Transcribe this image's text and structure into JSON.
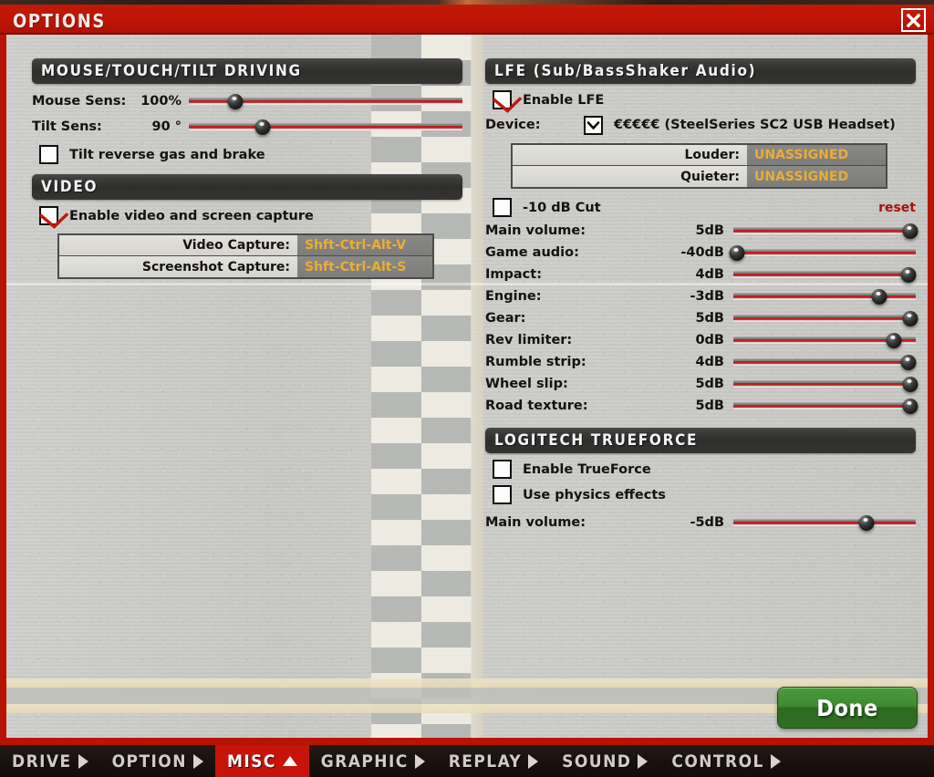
{
  "window": {
    "title": "OPTIONS",
    "close_icon": "close-x-icon"
  },
  "left_column": {
    "driving_section": {
      "header": "MOUSE/TOUCH/TILT DRIVING",
      "rows": [
        {
          "label": "Mouse Sens:",
          "value": "100%",
          "slider_pct": 17
        },
        {
          "label": "Tilt Sens:",
          "value": "90 °",
          "slider_pct": 27
        }
      ],
      "checkbox": {
        "label": "Tilt reverse gas and brake",
        "checked": false
      }
    },
    "video_section": {
      "header": "VIDEO",
      "checkbox": {
        "label": "Enable video and screen capture",
        "checked": true
      },
      "keybinds": [
        {
          "name": "Video Capture:",
          "value": "Shft-Ctrl-Alt-V"
        },
        {
          "name": "Screenshot Capture:",
          "value": "Shft-Ctrl-Alt-S"
        }
      ]
    }
  },
  "right_column": {
    "lfe_section": {
      "header": "LFE (Sub/BassShaker Audio)",
      "enable_checkbox": {
        "label": "Enable LFE",
        "checked": true
      },
      "device_label": "Device:",
      "device_value": "€€€€€ (SteelSeries SC2 USB Headset)",
      "device_icon": "chevron-down-icon",
      "keybinds": [
        {
          "name": "Louder:",
          "value": "UNASSIGNED"
        },
        {
          "name": "Quieter:",
          "value": "UNASSIGNED"
        }
      ],
      "cut_checkbox": {
        "label": "-10 dB Cut",
        "checked": false
      },
      "reset_label": "reset",
      "sliders": [
        {
          "label": "Main volume:",
          "value": "5dB",
          "slider_pct": 97
        },
        {
          "label": "Game audio:",
          "value": "-40dB",
          "slider_pct": 2
        },
        {
          "label": "Impact:",
          "value": "4dB",
          "slider_pct": 96
        },
        {
          "label": "Engine:",
          "value": "-3dB",
          "slider_pct": 80
        },
        {
          "label": "Gear:",
          "value": "5dB",
          "slider_pct": 97
        },
        {
          "label": "Rev limiter:",
          "value": "0dB",
          "slider_pct": 88
        },
        {
          "label": "Rumble strip:",
          "value": "4dB",
          "slider_pct": 96
        },
        {
          "label": "Wheel slip:",
          "value": "5dB",
          "slider_pct": 97
        },
        {
          "label": "Road texture:",
          "value": "5dB",
          "slider_pct": 97
        }
      ]
    },
    "trueforce_section": {
      "header": "LOGITECH TRUEFORCE",
      "checkboxes": [
        {
          "label": "Enable TrueForce",
          "checked": false
        },
        {
          "label": "Use physics effects",
          "checked": false
        }
      ],
      "slider": {
        "label": "Main volume:",
        "value": "-5dB",
        "slider_pct": 73
      }
    }
  },
  "done_button": {
    "label": "Done"
  },
  "tabbar": {
    "tabs": [
      {
        "label": "DRIVE",
        "arrow": "right",
        "active": false
      },
      {
        "label": "OPTION",
        "arrow": "right",
        "active": false
      },
      {
        "label": "MISC",
        "arrow": "up",
        "active": true
      },
      {
        "label": "GRAPHIC",
        "arrow": "right",
        "active": false
      },
      {
        "label": "REPLAY",
        "arrow": "right",
        "active": false
      },
      {
        "label": "SOUND",
        "arrow": "right",
        "active": false
      },
      {
        "label": "CONTROL",
        "arrow": "right",
        "active": false
      }
    ]
  },
  "colors": {
    "accent_red": "#b81404",
    "title_red": "#be1505",
    "keybind_gold": "#ecad34",
    "done_green": "#3f8a31",
    "reset_red": "#a31208"
  }
}
